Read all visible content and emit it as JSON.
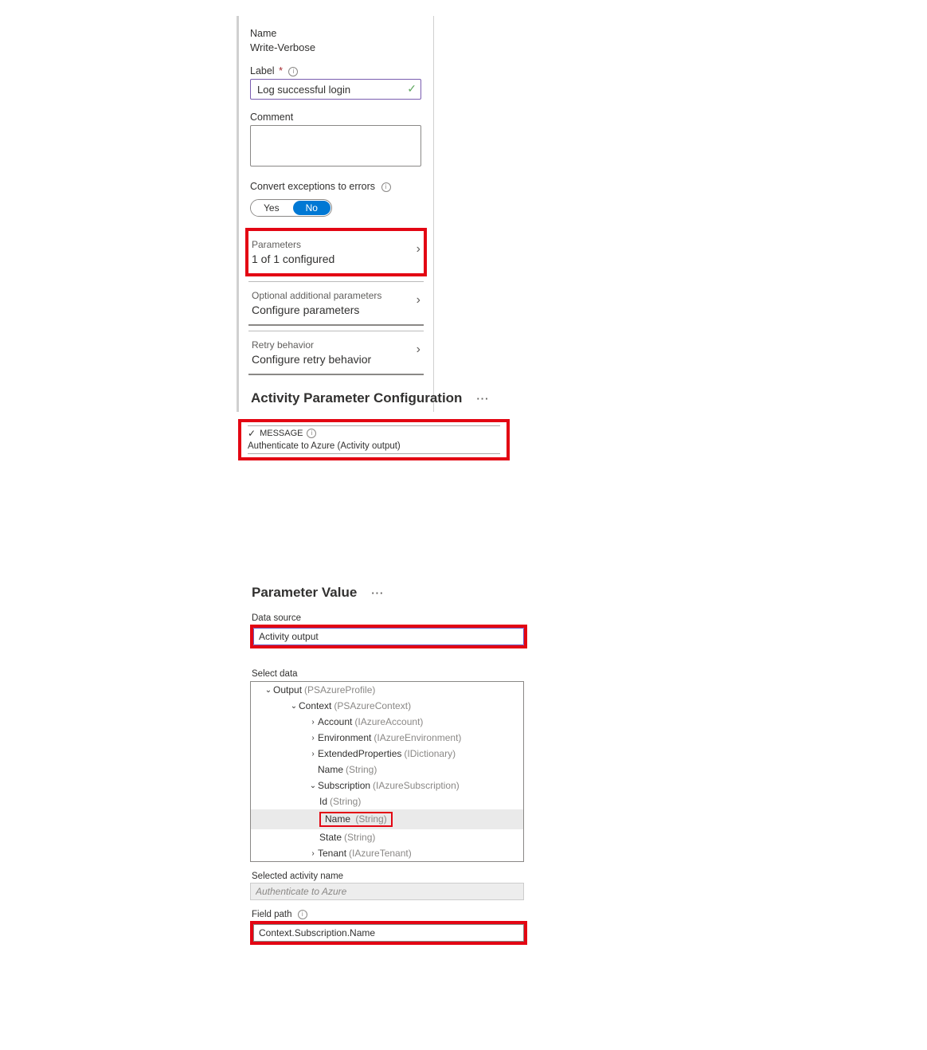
{
  "activity": {
    "name_label": "Name",
    "name_value": "Write-Verbose",
    "label_label": "Label",
    "label_required": "*",
    "label_value": "Log successful login",
    "comment_label": "Comment",
    "comment_value": "",
    "convert_label": "Convert exceptions to errors",
    "toggle_yes": "Yes",
    "toggle_no": "No"
  },
  "rows": {
    "parameters_title": "Parameters",
    "parameters_value": "1 of 1 configured",
    "optional_title": "Optional additional parameters",
    "optional_value": "Configure parameters",
    "retry_title": "Retry behavior",
    "retry_value": "Configure retry behavior"
  },
  "paramConfig": {
    "title": "Activity Parameter Configuration",
    "message_label": "MESSAGE",
    "message_value": "Authenticate to Azure (Activity output)"
  },
  "paramValue": {
    "title": "Parameter Value",
    "data_source_label": "Data source",
    "data_source_value": "Activity output",
    "select_data_label": "Select data",
    "tree": {
      "output": {
        "name": "Output",
        "type": "(PSAzureProfile)"
      },
      "context": {
        "name": "Context",
        "type": "(PSAzureContext)"
      },
      "account": {
        "name": "Account",
        "type": "(IAzureAccount)"
      },
      "environment": {
        "name": "Environment",
        "type": "(IAzureEnvironment)"
      },
      "extprops": {
        "name": "ExtendedProperties",
        "type": "(IDictionary)"
      },
      "ctx_name": {
        "name": "Name",
        "type": "(String)"
      },
      "subscription": {
        "name": "Subscription",
        "type": "(IAzureSubscription)"
      },
      "sub_id": {
        "name": "Id",
        "type": "(String)"
      },
      "sub_name": {
        "name": "Name",
        "type": "(String)"
      },
      "sub_state": {
        "name": "State",
        "type": "(String)"
      },
      "tenant": {
        "name": "Tenant",
        "type": "(IAzureTenant)"
      }
    },
    "selected_activity_label": "Selected activity name",
    "selected_activity_value": "Authenticate to Azure",
    "field_path_label": "Field path",
    "field_path_value": "Context.Subscription.Name"
  }
}
